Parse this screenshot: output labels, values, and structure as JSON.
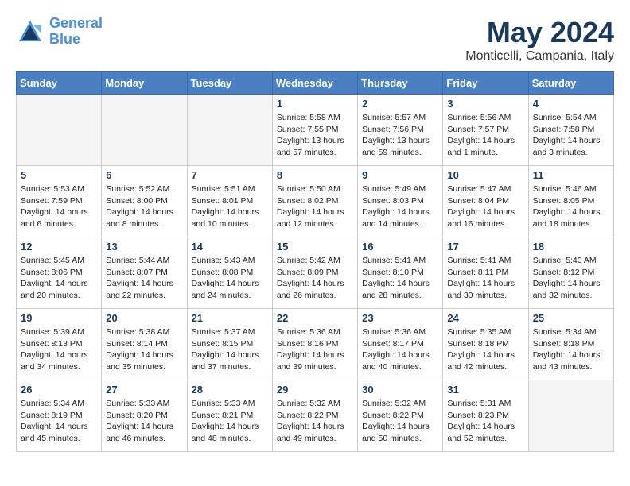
{
  "header": {
    "logo_line1": "General",
    "logo_line2": "Blue",
    "month": "May 2024",
    "location": "Monticelli, Campania, Italy"
  },
  "weekdays": [
    "Sunday",
    "Monday",
    "Tuesday",
    "Wednesday",
    "Thursday",
    "Friday",
    "Saturday"
  ],
  "weeks": [
    [
      {
        "day": "",
        "info": ""
      },
      {
        "day": "",
        "info": ""
      },
      {
        "day": "",
        "info": ""
      },
      {
        "day": "1",
        "info": "Sunrise: 5:58 AM\nSunset: 7:55 PM\nDaylight: 13 hours\nand 57 minutes."
      },
      {
        "day": "2",
        "info": "Sunrise: 5:57 AM\nSunset: 7:56 PM\nDaylight: 13 hours\nand 59 minutes."
      },
      {
        "day": "3",
        "info": "Sunrise: 5:56 AM\nSunset: 7:57 PM\nDaylight: 14 hours\nand 1 minute."
      },
      {
        "day": "4",
        "info": "Sunrise: 5:54 AM\nSunset: 7:58 PM\nDaylight: 14 hours\nand 3 minutes."
      }
    ],
    [
      {
        "day": "5",
        "info": "Sunrise: 5:53 AM\nSunset: 7:59 PM\nDaylight: 14 hours\nand 6 minutes."
      },
      {
        "day": "6",
        "info": "Sunrise: 5:52 AM\nSunset: 8:00 PM\nDaylight: 14 hours\nand 8 minutes."
      },
      {
        "day": "7",
        "info": "Sunrise: 5:51 AM\nSunset: 8:01 PM\nDaylight: 14 hours\nand 10 minutes."
      },
      {
        "day": "8",
        "info": "Sunrise: 5:50 AM\nSunset: 8:02 PM\nDaylight: 14 hours\nand 12 minutes."
      },
      {
        "day": "9",
        "info": "Sunrise: 5:49 AM\nSunset: 8:03 PM\nDaylight: 14 hours\nand 14 minutes."
      },
      {
        "day": "10",
        "info": "Sunrise: 5:47 AM\nSunset: 8:04 PM\nDaylight: 14 hours\nand 16 minutes."
      },
      {
        "day": "11",
        "info": "Sunrise: 5:46 AM\nSunset: 8:05 PM\nDaylight: 14 hours\nand 18 minutes."
      }
    ],
    [
      {
        "day": "12",
        "info": "Sunrise: 5:45 AM\nSunset: 8:06 PM\nDaylight: 14 hours\nand 20 minutes."
      },
      {
        "day": "13",
        "info": "Sunrise: 5:44 AM\nSunset: 8:07 PM\nDaylight: 14 hours\nand 22 minutes."
      },
      {
        "day": "14",
        "info": "Sunrise: 5:43 AM\nSunset: 8:08 PM\nDaylight: 14 hours\nand 24 minutes."
      },
      {
        "day": "15",
        "info": "Sunrise: 5:42 AM\nSunset: 8:09 PM\nDaylight: 14 hours\nand 26 minutes."
      },
      {
        "day": "16",
        "info": "Sunrise: 5:41 AM\nSunset: 8:10 PM\nDaylight: 14 hours\nand 28 minutes."
      },
      {
        "day": "17",
        "info": "Sunrise: 5:41 AM\nSunset: 8:11 PM\nDaylight: 14 hours\nand 30 minutes."
      },
      {
        "day": "18",
        "info": "Sunrise: 5:40 AM\nSunset: 8:12 PM\nDaylight: 14 hours\nand 32 minutes."
      }
    ],
    [
      {
        "day": "19",
        "info": "Sunrise: 5:39 AM\nSunset: 8:13 PM\nDaylight: 14 hours\nand 34 minutes."
      },
      {
        "day": "20",
        "info": "Sunrise: 5:38 AM\nSunset: 8:14 PM\nDaylight: 14 hours\nand 35 minutes."
      },
      {
        "day": "21",
        "info": "Sunrise: 5:37 AM\nSunset: 8:15 PM\nDaylight: 14 hours\nand 37 minutes."
      },
      {
        "day": "22",
        "info": "Sunrise: 5:36 AM\nSunset: 8:16 PM\nDaylight: 14 hours\nand 39 minutes."
      },
      {
        "day": "23",
        "info": "Sunrise: 5:36 AM\nSunset: 8:17 PM\nDaylight: 14 hours\nand 40 minutes."
      },
      {
        "day": "24",
        "info": "Sunrise: 5:35 AM\nSunset: 8:18 PM\nDaylight: 14 hours\nand 42 minutes."
      },
      {
        "day": "25",
        "info": "Sunrise: 5:34 AM\nSunset: 8:18 PM\nDaylight: 14 hours\nand 43 minutes."
      }
    ],
    [
      {
        "day": "26",
        "info": "Sunrise: 5:34 AM\nSunset: 8:19 PM\nDaylight: 14 hours\nand 45 minutes."
      },
      {
        "day": "27",
        "info": "Sunrise: 5:33 AM\nSunset: 8:20 PM\nDaylight: 14 hours\nand 46 minutes."
      },
      {
        "day": "28",
        "info": "Sunrise: 5:33 AM\nSunset: 8:21 PM\nDaylight: 14 hours\nand 48 minutes."
      },
      {
        "day": "29",
        "info": "Sunrise: 5:32 AM\nSunset: 8:22 PM\nDaylight: 14 hours\nand 49 minutes."
      },
      {
        "day": "30",
        "info": "Sunrise: 5:32 AM\nSunset: 8:22 PM\nDaylight: 14 hours\nand 50 minutes."
      },
      {
        "day": "31",
        "info": "Sunrise: 5:31 AM\nSunset: 8:23 PM\nDaylight: 14 hours\nand 52 minutes."
      },
      {
        "day": "",
        "info": ""
      }
    ]
  ]
}
